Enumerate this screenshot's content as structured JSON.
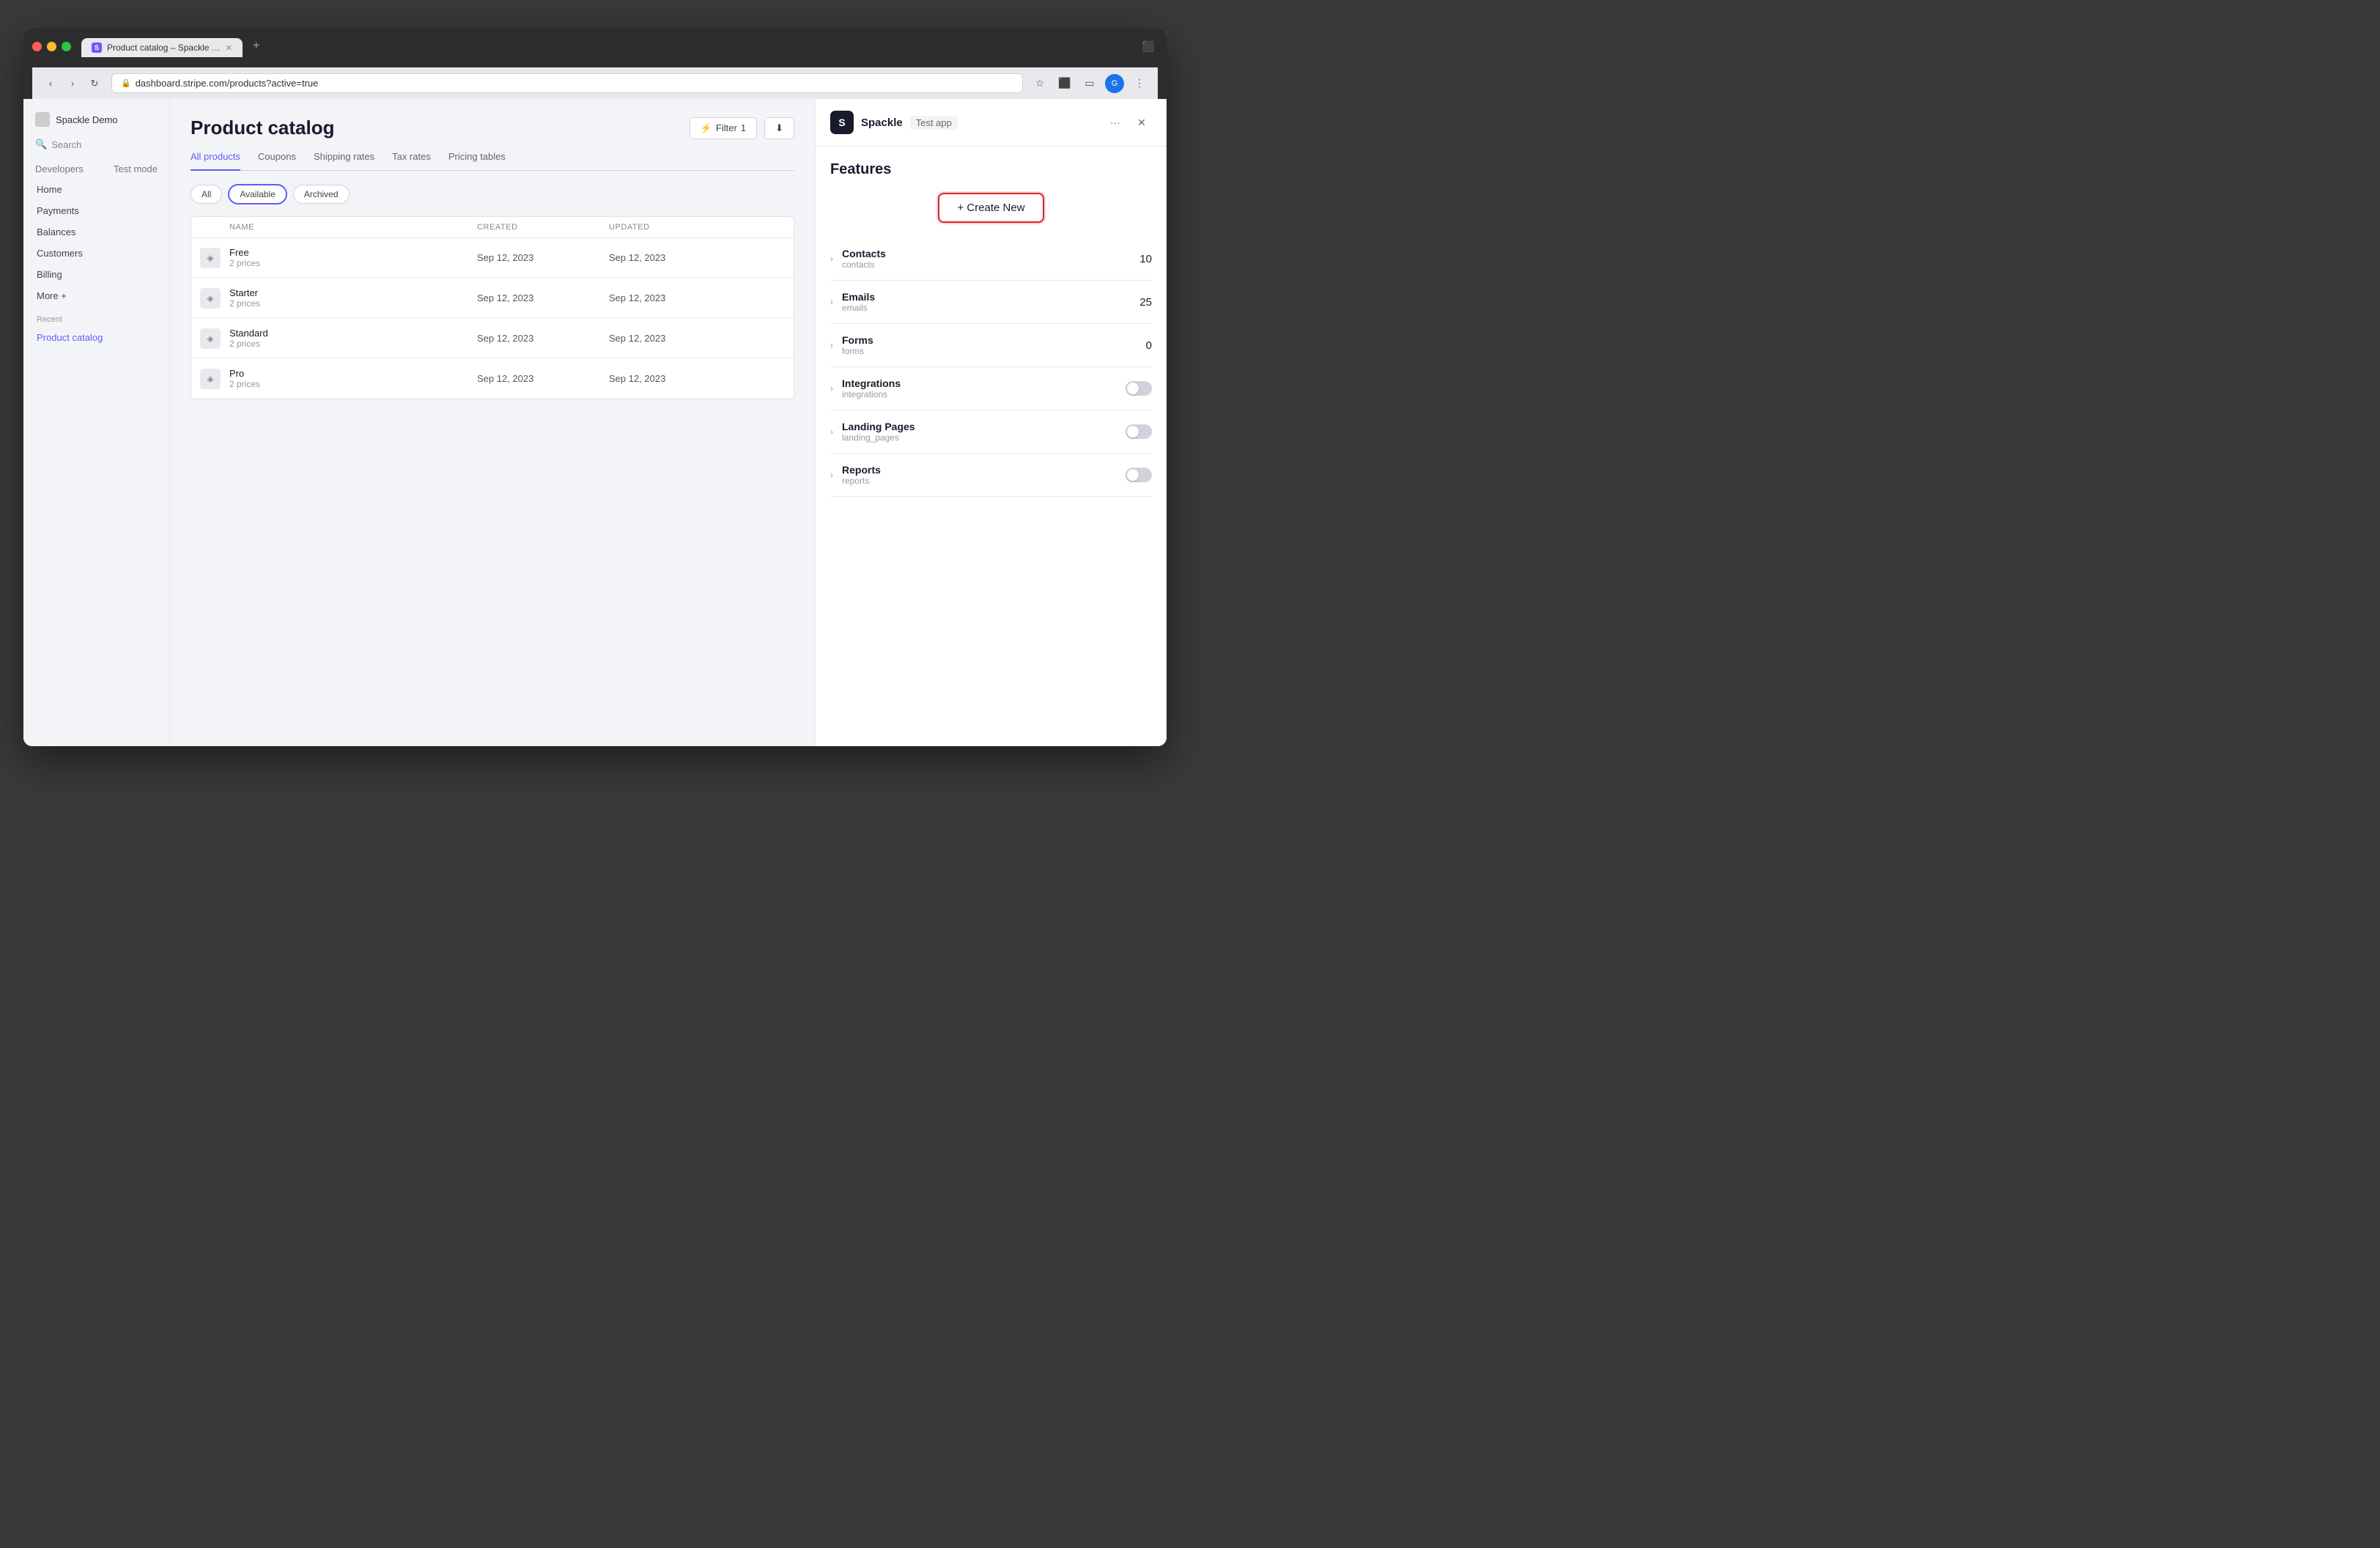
{
  "browser": {
    "tab_title": "Product catalog – Spackle De",
    "url": "dashboard.stripe.com/products?active=true",
    "favicon_letter": "S"
  },
  "sidebar": {
    "brand": "Spackle Demo",
    "nav_items": [
      {
        "label": "Home",
        "active": false
      },
      {
        "label": "Payments",
        "active": false
      },
      {
        "label": "Balances",
        "active": false
      },
      {
        "label": "Customers",
        "active": false
      },
      {
        "label": "Billing",
        "active": false
      },
      {
        "label": "More +",
        "active": false
      }
    ],
    "recent_label": "Recent",
    "recent_items": [
      {
        "label": "Product catalog",
        "active": true
      }
    ]
  },
  "stripe_main": {
    "page_title": "Product catalog",
    "header_actions": {
      "filter_label": "Filter",
      "filter_count": "1"
    },
    "tabs": [
      {
        "label": "All products",
        "active": true
      },
      {
        "label": "Coupons",
        "active": false
      },
      {
        "label": "Shipping rates",
        "active": false
      },
      {
        "label": "Tax rates",
        "active": false
      },
      {
        "label": "Pricing tables",
        "active": false
      }
    ],
    "filter_pills": [
      {
        "label": "All",
        "active": false
      },
      {
        "label": "Available",
        "active": true
      },
      {
        "label": "Archived",
        "active": false
      }
    ],
    "table": {
      "columns": [
        "",
        "NAME",
        "CREATED",
        "UPDATED",
        ""
      ],
      "rows": [
        {
          "icon": "◈",
          "name": "Free",
          "sub": "2 prices",
          "created": "Sep 12, 2023",
          "updated": "Sep 12, 2023"
        },
        {
          "icon": "◈",
          "name": "Starter",
          "sub": "2 prices",
          "created": "Sep 12, 2023",
          "updated": "Sep 12, 2023"
        },
        {
          "icon": "◈",
          "name": "Standard",
          "sub": "2 prices",
          "created": "Sep 12, 2023",
          "updated": "Sep 12, 2023"
        },
        {
          "icon": "◈",
          "name": "Pro",
          "sub": "2 prices",
          "created": "Sep 12, 2023",
          "updated": "Sep 12, 2023"
        }
      ]
    },
    "search_placeholder": "Search"
  },
  "spackle_panel": {
    "logo_letter": "S",
    "app_name": "Spackle",
    "app_badge": "Test app",
    "features_title": "Features",
    "create_new_label": "+ Create New",
    "features": [
      {
        "name": "Contacts",
        "key": "contacts",
        "value": "10",
        "type": "number"
      },
      {
        "name": "Emails",
        "key": "emails",
        "value": "25",
        "type": "number"
      },
      {
        "name": "Forms",
        "key": "forms",
        "value": "0",
        "type": "number"
      },
      {
        "name": "Integrations",
        "key": "integrations",
        "value": "",
        "type": "toggle"
      },
      {
        "name": "Landing Pages",
        "key": "landing_pages",
        "value": "",
        "type": "toggle"
      },
      {
        "name": "Reports",
        "key": "reports",
        "value": "",
        "type": "toggle"
      }
    ],
    "more_btn_label": "···",
    "close_btn_label": "✕"
  },
  "colors": {
    "accent": "#635bff",
    "danger": "#dc2626",
    "panel_bg": "#ffffff",
    "stripe_bg": "#f3f4f7"
  }
}
